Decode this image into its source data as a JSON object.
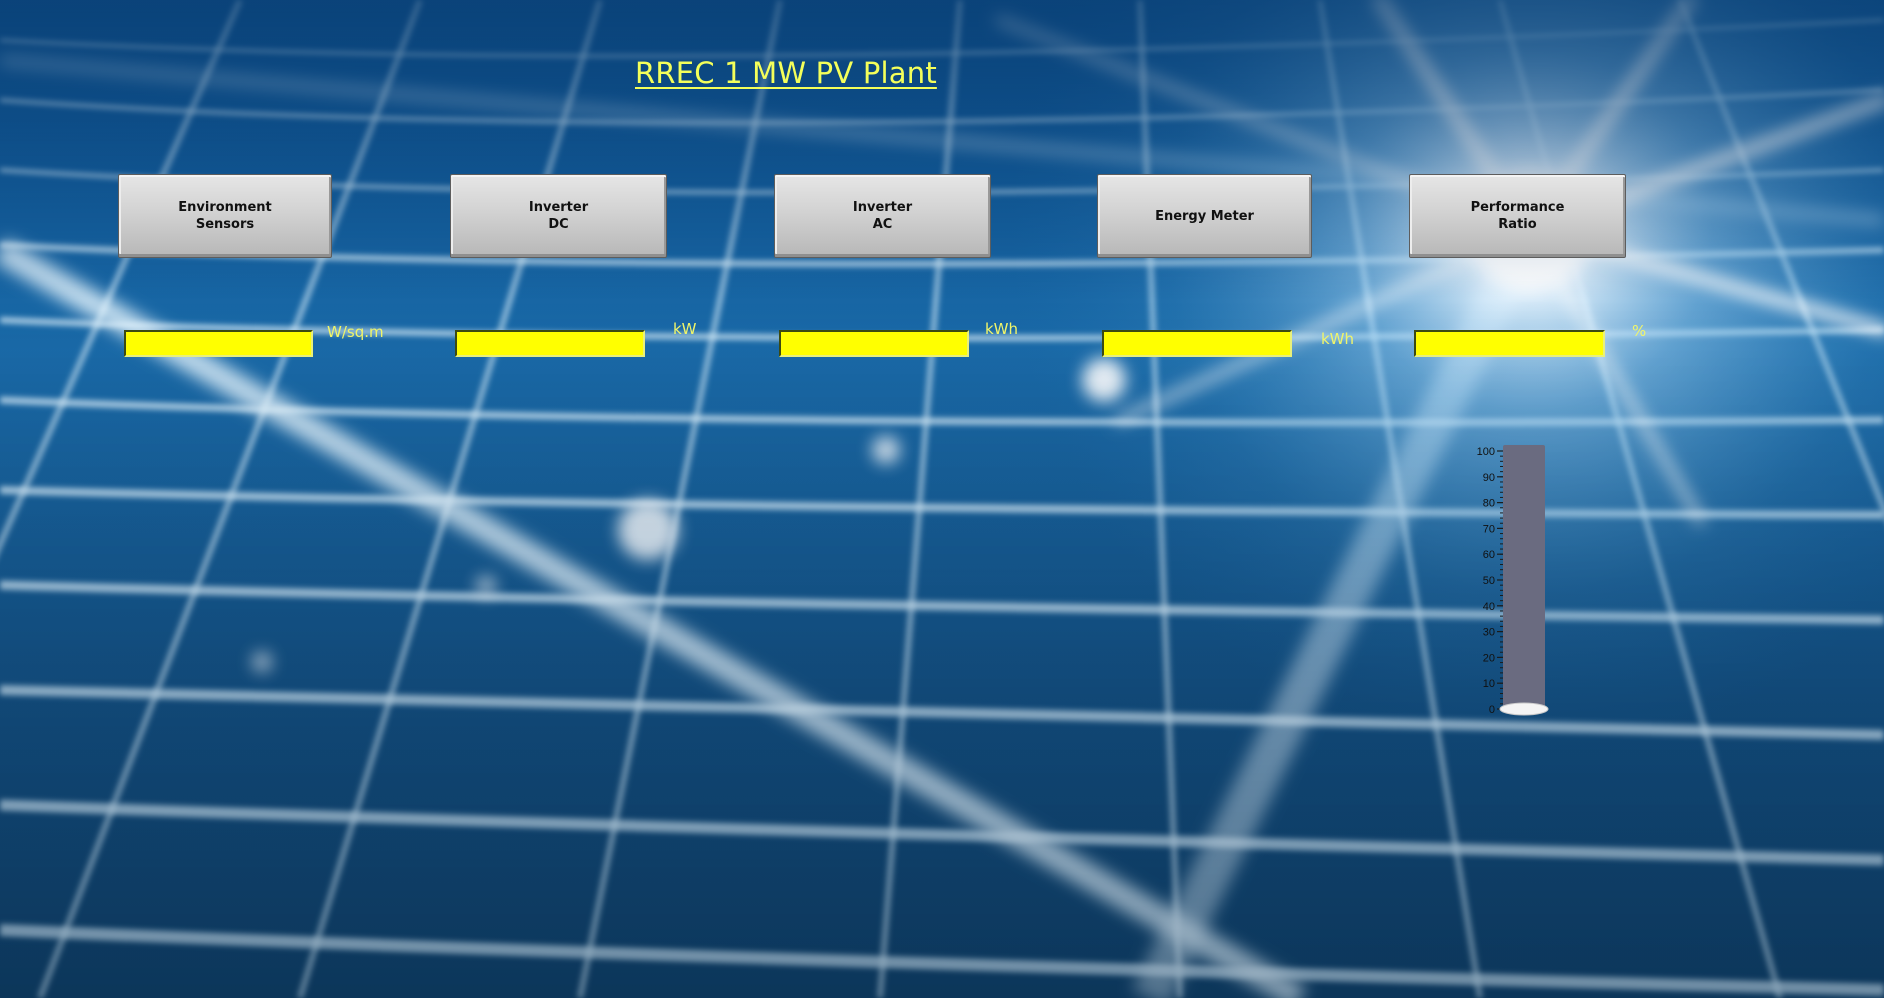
{
  "title": "RREC 1 MW PV Plant",
  "buttons": {
    "environment": "Environment\nSensors",
    "inverter_dc": "Inverter\nDC",
    "inverter_ac": "Inverter\nAC",
    "energy_meter": "Energy Meter",
    "performance_ratio": "Performance\nRatio"
  },
  "readings": {
    "environment": {
      "value": "",
      "unit": "W/sq.m"
    },
    "inverter_dc": {
      "value": "",
      "unit": "kW"
    },
    "inverter_ac": {
      "value": "",
      "unit": "kWh"
    },
    "energy_meter": {
      "value": "",
      "unit": "kWh"
    },
    "performance_ratio": {
      "value": "",
      "unit": "%"
    }
  },
  "gauge": {
    "ticks": [
      "0",
      "10",
      "20",
      "30",
      "40",
      "50",
      "60",
      "70",
      "80",
      "90",
      "100"
    ],
    "min": 0,
    "max": 100,
    "level": 0
  },
  "colors": {
    "title": "#f4ff5a",
    "value_box": "#ffff00",
    "unit_text": "#f0f56a",
    "gauge_fill": "#6a6b80"
  }
}
